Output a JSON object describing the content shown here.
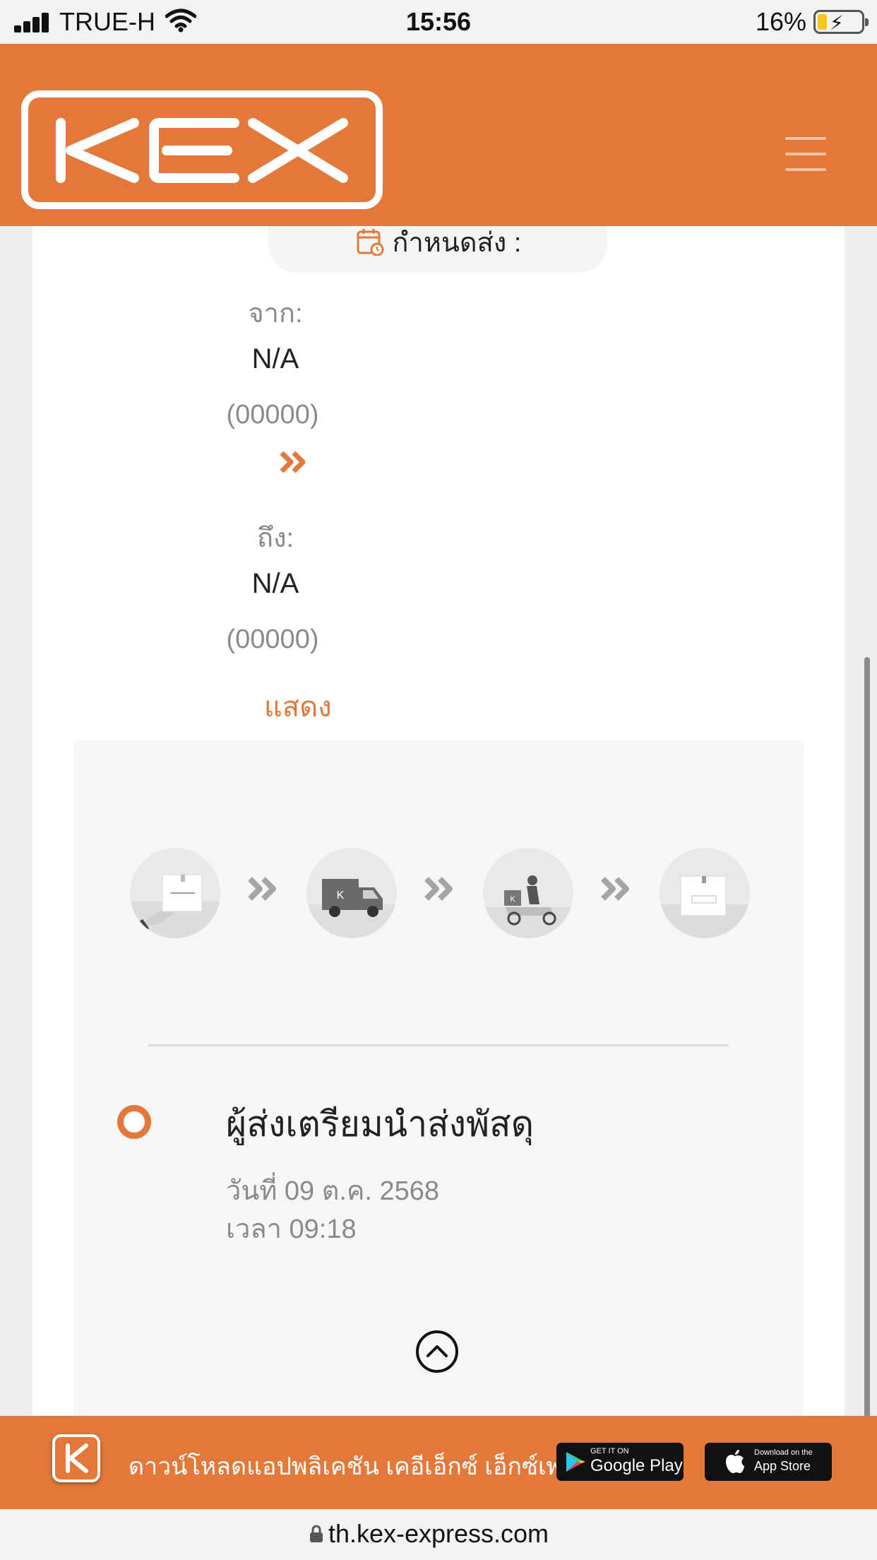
{
  "status_bar": {
    "carrier": "TRUE-H",
    "time": "15:56",
    "battery_percent": "16%",
    "battery_level": 0.16,
    "icons": [
      "signal-icon",
      "wifi-icon",
      "battery-charging-icon"
    ]
  },
  "header": {
    "logo_text": "KEX",
    "menu_icon": "hamburger-menu-icon",
    "brand_color": "#e3783a"
  },
  "shipment": {
    "due_label": "กำหนดส่ง :",
    "from_label": "จาก:",
    "from_value": "N/A",
    "from_code": "(00000)",
    "to_label": "ถึง:",
    "to_value": "N/A",
    "to_code": "(00000)",
    "show_link": "แสดง"
  },
  "tracking": {
    "steps": [
      {
        "icon": "package-handover-icon"
      },
      {
        "icon": "delivery-truck-icon"
      },
      {
        "icon": "delivery-scooter-icon"
      },
      {
        "icon": "package-delivered-icon"
      }
    ],
    "event_title": "ผู้ส่งเตรียมนำส่งพัสดุ",
    "event_date": "วันที่ 09 ต.ค. 2568",
    "event_time": "เวลา 09:18",
    "collapse_icon": "chevron-up-circle-icon"
  },
  "app_banner": {
    "text": "ดาวน์โหลดแอปพลิเคชัน เคอีเอ็กซ์ เอ็กซ์เพรส",
    "google_play_small": "GET IT ON",
    "google_play_big": "Google Play",
    "app_store_small": "Download on the",
    "app_store_big": "App Store"
  },
  "url_bar": {
    "url": "th.kex-express.com"
  }
}
